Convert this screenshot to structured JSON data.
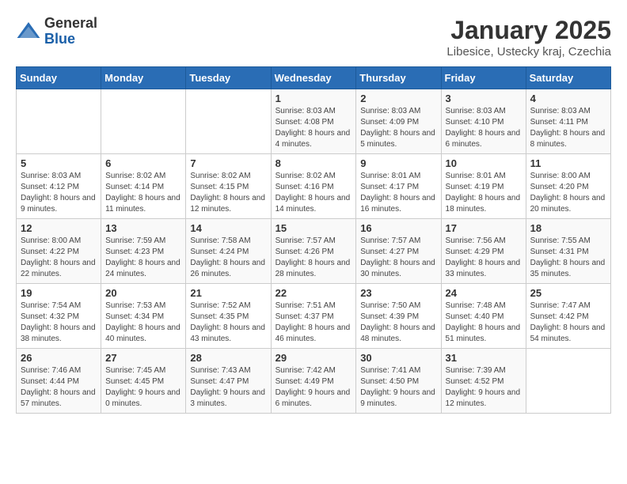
{
  "header": {
    "logo_general": "General",
    "logo_blue": "Blue",
    "month_title": "January 2025",
    "location": "Libesice, Ustecky kraj, Czechia"
  },
  "weekdays": [
    "Sunday",
    "Monday",
    "Tuesday",
    "Wednesday",
    "Thursday",
    "Friday",
    "Saturday"
  ],
  "weeks": [
    [
      {
        "day": "",
        "detail": ""
      },
      {
        "day": "",
        "detail": ""
      },
      {
        "day": "",
        "detail": ""
      },
      {
        "day": "1",
        "detail": "Sunrise: 8:03 AM\nSunset: 4:08 PM\nDaylight: 8 hours\nand 4 minutes."
      },
      {
        "day": "2",
        "detail": "Sunrise: 8:03 AM\nSunset: 4:09 PM\nDaylight: 8 hours\nand 5 minutes."
      },
      {
        "day": "3",
        "detail": "Sunrise: 8:03 AM\nSunset: 4:10 PM\nDaylight: 8 hours\nand 6 minutes."
      },
      {
        "day": "4",
        "detail": "Sunrise: 8:03 AM\nSunset: 4:11 PM\nDaylight: 8 hours\nand 8 minutes."
      }
    ],
    [
      {
        "day": "5",
        "detail": "Sunrise: 8:03 AM\nSunset: 4:12 PM\nDaylight: 8 hours\nand 9 minutes."
      },
      {
        "day": "6",
        "detail": "Sunrise: 8:02 AM\nSunset: 4:14 PM\nDaylight: 8 hours\nand 11 minutes."
      },
      {
        "day": "7",
        "detail": "Sunrise: 8:02 AM\nSunset: 4:15 PM\nDaylight: 8 hours\nand 12 minutes."
      },
      {
        "day": "8",
        "detail": "Sunrise: 8:02 AM\nSunset: 4:16 PM\nDaylight: 8 hours\nand 14 minutes."
      },
      {
        "day": "9",
        "detail": "Sunrise: 8:01 AM\nSunset: 4:17 PM\nDaylight: 8 hours\nand 16 minutes."
      },
      {
        "day": "10",
        "detail": "Sunrise: 8:01 AM\nSunset: 4:19 PM\nDaylight: 8 hours\nand 18 minutes."
      },
      {
        "day": "11",
        "detail": "Sunrise: 8:00 AM\nSunset: 4:20 PM\nDaylight: 8 hours\nand 20 minutes."
      }
    ],
    [
      {
        "day": "12",
        "detail": "Sunrise: 8:00 AM\nSunset: 4:22 PM\nDaylight: 8 hours\nand 22 minutes."
      },
      {
        "day": "13",
        "detail": "Sunrise: 7:59 AM\nSunset: 4:23 PM\nDaylight: 8 hours\nand 24 minutes."
      },
      {
        "day": "14",
        "detail": "Sunrise: 7:58 AM\nSunset: 4:24 PM\nDaylight: 8 hours\nand 26 minutes."
      },
      {
        "day": "15",
        "detail": "Sunrise: 7:57 AM\nSunset: 4:26 PM\nDaylight: 8 hours\nand 28 minutes."
      },
      {
        "day": "16",
        "detail": "Sunrise: 7:57 AM\nSunset: 4:27 PM\nDaylight: 8 hours\nand 30 minutes."
      },
      {
        "day": "17",
        "detail": "Sunrise: 7:56 AM\nSunset: 4:29 PM\nDaylight: 8 hours\nand 33 minutes."
      },
      {
        "day": "18",
        "detail": "Sunrise: 7:55 AM\nSunset: 4:31 PM\nDaylight: 8 hours\nand 35 minutes."
      }
    ],
    [
      {
        "day": "19",
        "detail": "Sunrise: 7:54 AM\nSunset: 4:32 PM\nDaylight: 8 hours\nand 38 minutes."
      },
      {
        "day": "20",
        "detail": "Sunrise: 7:53 AM\nSunset: 4:34 PM\nDaylight: 8 hours\nand 40 minutes."
      },
      {
        "day": "21",
        "detail": "Sunrise: 7:52 AM\nSunset: 4:35 PM\nDaylight: 8 hours\nand 43 minutes."
      },
      {
        "day": "22",
        "detail": "Sunrise: 7:51 AM\nSunset: 4:37 PM\nDaylight: 8 hours\nand 46 minutes."
      },
      {
        "day": "23",
        "detail": "Sunrise: 7:50 AM\nSunset: 4:39 PM\nDaylight: 8 hours\nand 48 minutes."
      },
      {
        "day": "24",
        "detail": "Sunrise: 7:48 AM\nSunset: 4:40 PM\nDaylight: 8 hours\nand 51 minutes."
      },
      {
        "day": "25",
        "detail": "Sunrise: 7:47 AM\nSunset: 4:42 PM\nDaylight: 8 hours\nand 54 minutes."
      }
    ],
    [
      {
        "day": "26",
        "detail": "Sunrise: 7:46 AM\nSunset: 4:44 PM\nDaylight: 8 hours\nand 57 minutes."
      },
      {
        "day": "27",
        "detail": "Sunrise: 7:45 AM\nSunset: 4:45 PM\nDaylight: 9 hours\nand 0 minutes."
      },
      {
        "day": "28",
        "detail": "Sunrise: 7:43 AM\nSunset: 4:47 PM\nDaylight: 9 hours\nand 3 minutes."
      },
      {
        "day": "29",
        "detail": "Sunrise: 7:42 AM\nSunset: 4:49 PM\nDaylight: 9 hours\nand 6 minutes."
      },
      {
        "day": "30",
        "detail": "Sunrise: 7:41 AM\nSunset: 4:50 PM\nDaylight: 9 hours\nand 9 minutes."
      },
      {
        "day": "31",
        "detail": "Sunrise: 7:39 AM\nSunset: 4:52 PM\nDaylight: 9 hours\nand 12 minutes."
      },
      {
        "day": "",
        "detail": ""
      }
    ]
  ]
}
